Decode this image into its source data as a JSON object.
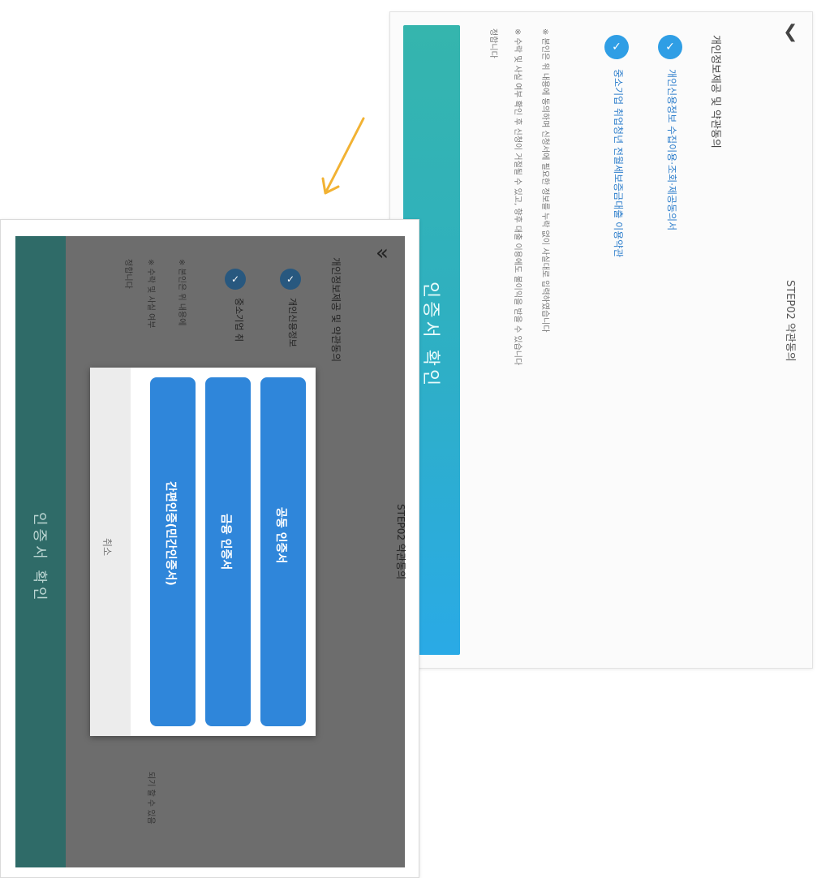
{
  "annotation": {
    "arrow_color": "#f2b233"
  },
  "back_screen": {
    "back_icon": "chevron-left-icon",
    "step_title": "STEP02 약관동의",
    "section_title": "개인정보제공 및 약관동의",
    "agree_items": [
      {
        "icon": "check-icon",
        "label": "개인신용정보 수집이용·조회·제공동의서"
      },
      {
        "icon": "check-icon",
        "label": "중소기업 취업청년 전월세보증금대출 이용약관"
      }
    ],
    "notes": [
      "※ 본인은 위 내용에 동의하며 신청서에 필요한 정보를 누락 없이 사실대로 입력하였습니다",
      "※ 수락 및 사실 여부 확인 후 신청이 거절될 수 있고, 향후 대출 이용에도 불이익을 받을 수 있습니다",
      "정합니다"
    ],
    "confirm_button": "인증서 확인",
    "accent_gradient": [
      "#35b5ad",
      "#2aaae6"
    ]
  },
  "front_screen": {
    "back_icon": "double-chevron-left-icon",
    "step_title": "STEP02 약관동의",
    "section_title": "개인정보제공 및 약관동의",
    "agree_items": [
      {
        "icon": "check-icon",
        "label": "개인신용정보"
      },
      {
        "icon": "check-icon",
        "label": "중소기업 취"
      }
    ],
    "notes": [
      "※ 본인은 위 내용에",
      "※ 수락 및 사실 여부",
      "정합니다"
    ],
    "note_tail": "되기 할 수 있음",
    "confirm_button": "인증서 확인",
    "dialog": {
      "options": [
        "공동 인증서",
        "금융 인증서",
        "간편인증(민간인증서)"
      ],
      "cancel": "취소",
      "button_color": "#2f86da"
    }
  }
}
